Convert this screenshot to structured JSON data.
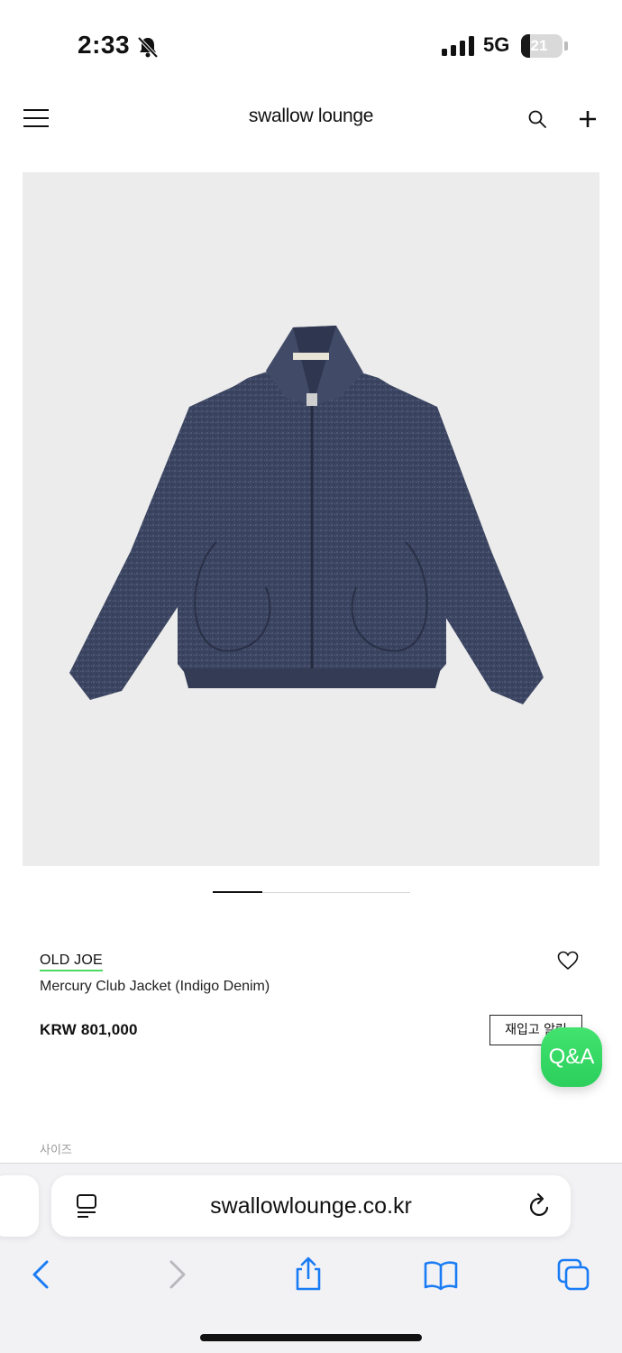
{
  "status_bar": {
    "time": "2:33",
    "network": "5G",
    "battery": "21",
    "battery_level": 0.21
  },
  "header": {
    "logo": "swallow lounge"
  },
  "gallery": {
    "current_slide": 1,
    "slide_count": 4
  },
  "product": {
    "brand": "OLD JOE",
    "name": "Mercury Club Jacket (Indigo Denim)",
    "price": "KRW 801,000",
    "restock_button": "재입고 알림",
    "qa_button": "Q&A",
    "size_label": "사이즈"
  },
  "browser": {
    "url": "swallowlounge.co.kr"
  },
  "colors": {
    "accent_green": "#3ddc68",
    "icon_blue": "#1a7cf5",
    "image_bg": "#ececec"
  },
  "icons": [
    "bell-slash-icon",
    "signal-icon",
    "menu-icon",
    "search-icon",
    "plus-icon",
    "heart-icon",
    "reader-icon",
    "reload-icon",
    "back-icon",
    "forward-icon",
    "share-icon",
    "bookmarks-icon",
    "tabs-icon"
  ]
}
